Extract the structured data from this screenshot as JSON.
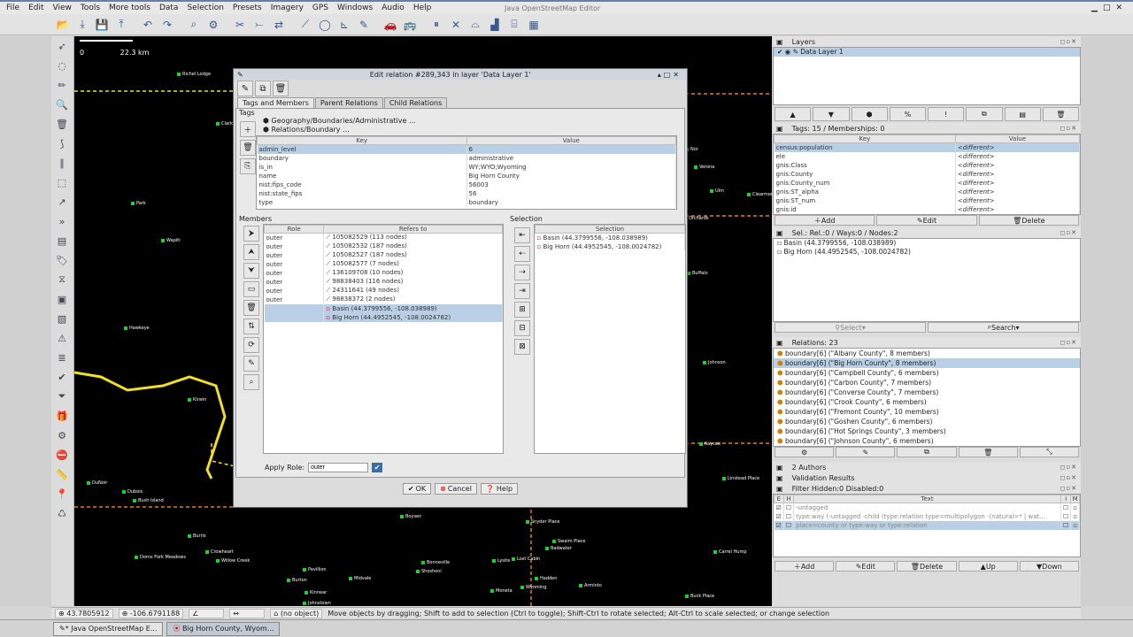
{
  "menu": [
    "File",
    "Edit",
    "View",
    "Tools",
    "More tools",
    "Data",
    "Selection",
    "Presets",
    "Imagery",
    "GPS",
    "Windows",
    "Audio",
    "Help"
  ],
  "app_title": "Java OpenStreetMap Editor",
  "map": {
    "scale_start": "0",
    "scale_label": "22.3 km",
    "places": [
      "Richel Lodge",
      "Clark",
      "Park",
      "Wapiti",
      "Hawkeye",
      "Kirwin",
      "DuNoir",
      "Dubois",
      "Bush Island",
      "Burris",
      "Crowheart",
      "Willow Creek",
      "Dorns Fork Meadows",
      "Pavillion",
      "Burton",
      "Kinnear",
      "Midvale",
      "Johnstown",
      "Boysen",
      "Snyder Place",
      "Swaim Place",
      "Badwater",
      "Bonneville",
      "Shoshoni",
      "Lysite",
      "Lost Cabin",
      "Moneta",
      "Wyoming",
      "Hadden",
      "Arminto",
      "Verona",
      "Ulm",
      "Clearmont",
      "Buffalo",
      "Johnson",
      "Kaycee",
      "Linstead Place",
      "Carrel Hump",
      "Buck Place",
      "Orchards",
      "Nor"
    ]
  },
  "dialog": {
    "title": "Edit relation #289,343 in layer 'Data Layer 1'",
    "tabs": [
      "Tags and Members",
      "Parent Relations",
      "Child Relations"
    ],
    "tags_label": "Tags",
    "presets": [
      "Geography/Boundaries/Administrative ...",
      "Relations/Boundary ..."
    ],
    "tags_headers": [
      "Key",
      "Value"
    ],
    "tags": [
      {
        "key": "admin_level",
        "value": "6"
      },
      {
        "key": "boundary",
        "value": "administrative"
      },
      {
        "key": "is_in",
        "value": "WY;WYO;Wyoming"
      },
      {
        "key": "name",
        "value": "Big Horn County"
      },
      {
        "key": "nist:fips_code",
        "value": "56003"
      },
      {
        "key": "nist:state_fips",
        "value": "56"
      },
      {
        "key": "type",
        "value": "boundary"
      }
    ],
    "members_label": "Members",
    "members_headers": [
      "Role",
      "Refers to"
    ],
    "members": [
      {
        "role": "outer",
        "ref": "105082529 (113 nodes)"
      },
      {
        "role": "outer",
        "ref": "105082532 (187 nodes)"
      },
      {
        "role": "outer",
        "ref": "105082527 (187 nodes)"
      },
      {
        "role": "outer",
        "ref": "105082577 (7 nodes)"
      },
      {
        "role": "outer",
        "ref": "136109708 (10 nodes)"
      },
      {
        "role": "outer",
        "ref": "98838403 (116 nodes)"
      },
      {
        "role": "outer",
        "ref": "24311641 (49 nodes)"
      },
      {
        "role": "outer",
        "ref": "98838372 (2 nodes)"
      },
      {
        "role": "",
        "ref": "Basin (44.3799556, -108.038989)"
      },
      {
        "role": "",
        "ref": "Big Horn (44.4952545, -108.0024782)"
      }
    ],
    "selection_label": "Selection",
    "selection_header": "Selection",
    "selection": [
      "Basin (44.3799556, -108.038989)",
      "Big Horn (44.4952545, -108.0024782)"
    ],
    "apply_role_label": "Apply Role:",
    "apply_role_value": "outer",
    "ok": "OK",
    "cancel": "Cancel",
    "help": "Help"
  },
  "layers": {
    "title": "Layers",
    "items": [
      "Data Layer 1"
    ]
  },
  "tags_panel": {
    "title": "Tags: 15 / Memberships: 0",
    "headers": [
      "Key",
      "Value"
    ],
    "rows": [
      {
        "key": "census:population",
        "value": "<different>"
      },
      {
        "key": "ele",
        "value": "<different>"
      },
      {
        "key": "gnis:Class",
        "value": "<different>"
      },
      {
        "key": "gnis:County",
        "value": "<different>"
      },
      {
        "key": "gnis:County_num",
        "value": "<different>"
      },
      {
        "key": "gnis:ST_alpha",
        "value": "<different>"
      },
      {
        "key": "gnis:ST_num",
        "value": "<different>"
      },
      {
        "key": "gnis:id",
        "value": "<different>"
      }
    ],
    "add": "Add",
    "edit": "Edit",
    "delete": "Delete"
  },
  "sel_panel": {
    "title": "Sel.: Rel.:0 / Ways:0 / Nodes:2",
    "items": [
      "Basin (44.3799556, -108.038989)",
      "Big Horn (44.4952545, -108.0024782)"
    ],
    "select": "Select",
    "search": "Search"
  },
  "relations_panel": {
    "title": "Relations: 23",
    "items": [
      "boundary[6] (\"Albany County\", 8 members)",
      "boundary[6] (\"Big Horn County\", 8 members)",
      "boundary[6] (\"Campbell County\", 6 members)",
      "boundary[6] (\"Carbon County\", 7 members)",
      "boundary[6] (\"Converse County\", 7 members)",
      "boundary[6] (\"Crook County\", 6 members)",
      "boundary[6] (\"Fremont County\", 10 members)",
      "boundary[6] (\"Goshen County\", 6 members)",
      "boundary[6] (\"Hot Springs County\", 3 members)",
      "boundary[6] (\"Johnson County\", 6 members)"
    ]
  },
  "authors_title": "2 Authors",
  "validation_title": "Validation Results",
  "filter_panel": {
    "title": "Filter Hidden:0 Disabled:0",
    "headers": [
      "E",
      "H",
      "Text",
      "I",
      "M"
    ],
    "rows": [
      "-untagged",
      "type:way (-untagged -child (type:relation type=multipolygon -(natural=* | wat...",
      "place=county or type:way or type:relation"
    ],
    "add": "Add",
    "edit": "Edit",
    "delete": "Delete",
    "up": "Up",
    "down": "Down"
  },
  "status": {
    "lat": "43.7805912",
    "lon": "-106.6791188",
    "object": "(no object)",
    "hint": "Move objects by dragging; Shift to add to selection (Ctrl to toggle); Shift-Ctrl to rotate selected; Alt-Ctrl to scale selected; or change selection"
  },
  "taskbar": [
    "* Java OpenStreetMap E...",
    "Big Horn County, Wyom..."
  ],
  "colors": {
    "accent": "#b8cfe5",
    "map_bg": "#000000",
    "boundary": "#f0e020",
    "place_marker": "#1fce2f"
  }
}
